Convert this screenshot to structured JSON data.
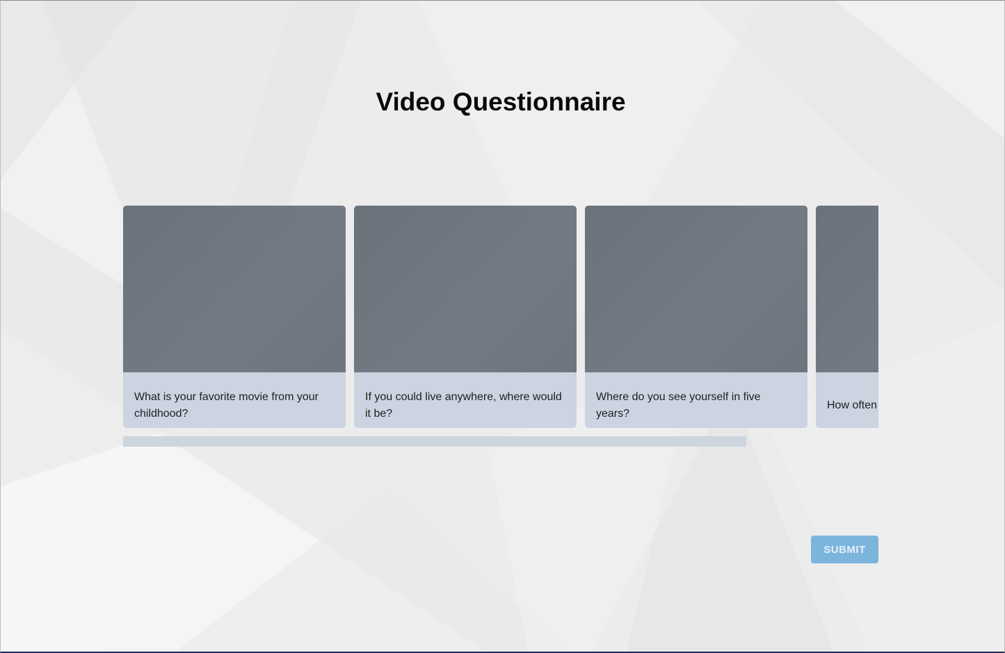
{
  "page": {
    "title": "Video Questionnaire"
  },
  "questions": [
    {
      "text": "What is your favorite movie from your childhood?"
    },
    {
      "text": "If you could live anywhere, where would it be?"
    },
    {
      "text": "Where do you see yourself in five years?"
    },
    {
      "text": "How often"
    }
  ],
  "actions": {
    "submit_label": "SUBMIT"
  },
  "colors": {
    "video_placeholder": "#6e7580",
    "caption_background": "#cbd4e0",
    "scrollbar": "#cdd5df",
    "submit_button": "#7cb5dc"
  }
}
